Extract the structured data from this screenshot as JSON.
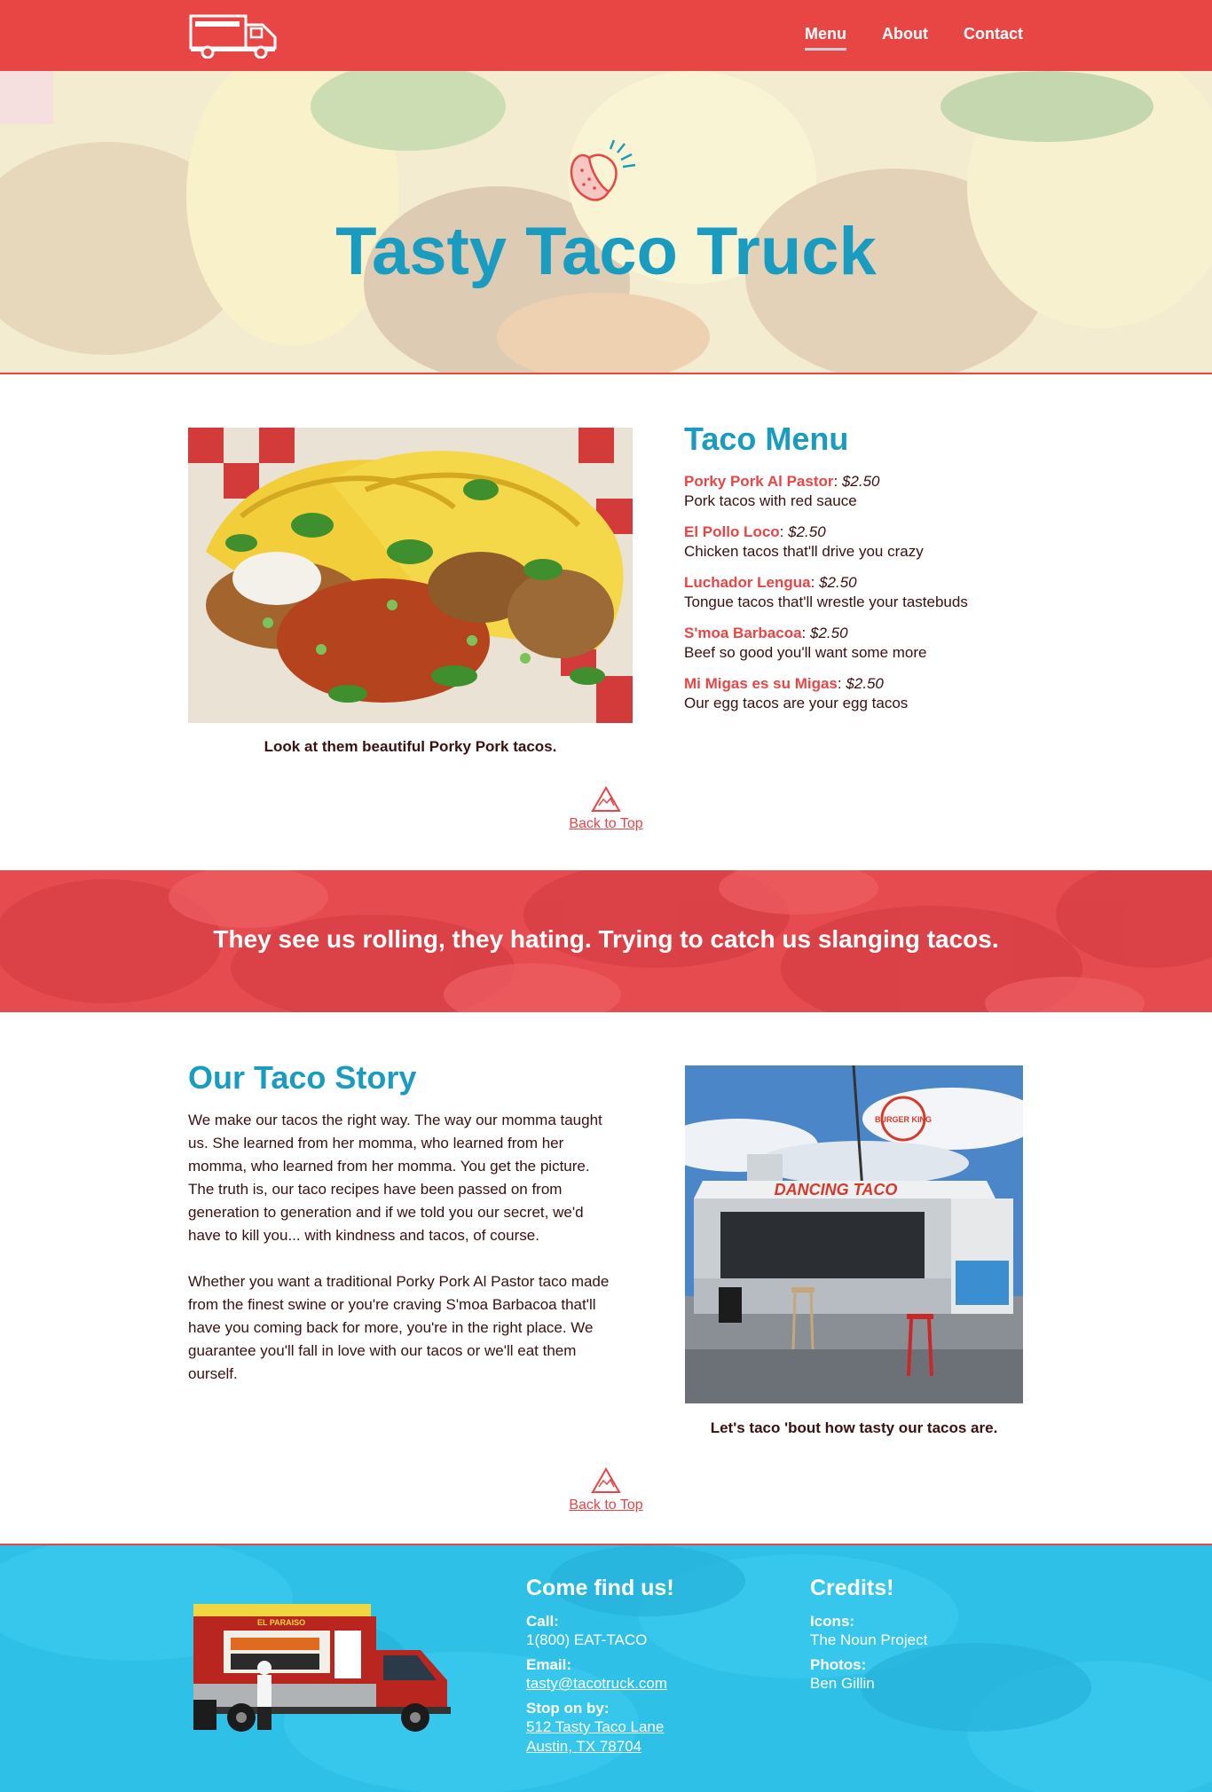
{
  "nav": {
    "links": [
      {
        "label": "Menu",
        "active": true
      },
      {
        "label": "About",
        "active": false
      },
      {
        "label": "Contact",
        "active": false
      }
    ]
  },
  "hero": {
    "title": "Tasty Taco Truck"
  },
  "menu": {
    "heading": "Taco Menu",
    "photo_caption": "Look at them beautiful Porky Pork tacos.",
    "items": [
      {
        "name": "Porky Pork Al Pastor",
        "price": "$2.50",
        "desc": "Pork tacos with red sauce"
      },
      {
        "name": "El Pollo Loco",
        "price": "$2.50",
        "desc": "Chicken tacos that'll drive you crazy"
      },
      {
        "name": "Luchador Lengua",
        "price": "$2.50",
        "desc": "Tongue tacos that'll wrestle your tastebuds"
      },
      {
        "name": "S'moa Barbacoa",
        "price": "$2.50",
        "desc": "Beef so good you'll want some more"
      },
      {
        "name": "Mi Migas es su Migas",
        "price": "$2.50",
        "desc": "Our egg tacos are your egg tacos"
      }
    ],
    "back_to_top": "Back to Top"
  },
  "quote": {
    "text": "They see us rolling, they hating. Trying to catch us slanging tacos."
  },
  "story": {
    "heading": "Our Taco Story",
    "paragraphs": [
      "We make our tacos the right way. The way our momma taught us. She learned from her momma, who learned from her momma, who learned from her momma. You get the picture. The truth is, our taco recipes have been passed on from generation to generation and if we told you our secret, we'd have to kill you... with kindness and tacos, of course.",
      "Whether you want a traditional Porky Pork Al Pastor taco made from the finest swine or you're craving S'moa Barbacoa that'll have you coming back for more, you're in the right place. We guarantee you'll fall in love with our tacos or we'll eat them ourself."
    ],
    "photo_caption": "Let's taco 'bout how tasty our tacos are.",
    "photo_sign_text": "DANCING TACO",
    "photo_logo_text": "BURGER KING",
    "back_to_top": "Back to Top"
  },
  "footer": {
    "find": {
      "heading": "Come find us!",
      "call_label": "Call:",
      "call_value": "1(800) EAT-TACO",
      "email_label": "Email:",
      "email_value": "tasty@tacotruck.com",
      "stop_label": "Stop on by:",
      "address_line1": "512 Tasty Taco Lane",
      "address_line2": "Austin, TX 78704"
    },
    "credits": {
      "heading": "Credits!",
      "icons_label": "Icons:",
      "icons_value": "The Noun Project",
      "photos_label": "Photos:",
      "photos_value": "Ben Gillin"
    },
    "truck_sign_text": "EL PARAISO"
  },
  "colors": {
    "brand_red": "#e84545",
    "brand_blue": "#1a9cc0",
    "footer_blue": "#2fc0e8",
    "text_dark": "#3a1010"
  },
  "icons": [
    "food-truck-logo-icon",
    "taco-icon",
    "back-to-top-icon"
  ]
}
